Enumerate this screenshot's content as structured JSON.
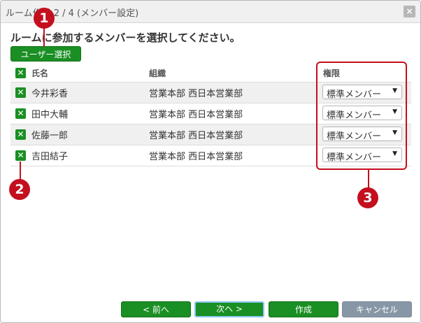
{
  "dialog": {
    "title": "ルーム作成 2 / 4 (メンバー設定)",
    "close_icon": "×"
  },
  "main": {
    "heading": "ルームに参加するメンバーを選択してください。",
    "user_select_label": "ユーザー選択"
  },
  "table": {
    "columns": [
      "氏名",
      "組織",
      "権限"
    ],
    "rows": [
      {
        "name": "今井彩香",
        "org": "営業本部 西日本営業部",
        "role": "標準メンバー"
      },
      {
        "name": "田中大輔",
        "org": "営業本部 西日本営業部",
        "role": "標準メンバー"
      },
      {
        "name": "佐藤一郎",
        "org": "営業本部 西日本営業部",
        "role": "標準メンバー"
      },
      {
        "name": "吉田結子",
        "org": "営業本部 西日本営業部",
        "role": "標準メンバー"
      }
    ]
  },
  "icons": {
    "check_mark": "✕",
    "dropdown_arrow": "▼"
  },
  "annotations": {
    "badge1": "1",
    "badge2": "2",
    "badge3": "3",
    "color": "#c40f1e"
  },
  "footer": {
    "prev_label": "< 前へ",
    "next_label": "次へ >",
    "create_label": "作成",
    "cancel_label": "キャンセル"
  },
  "colors": {
    "primary_green": "#1a8f23",
    "secondary_gray": "#8897a6"
  }
}
